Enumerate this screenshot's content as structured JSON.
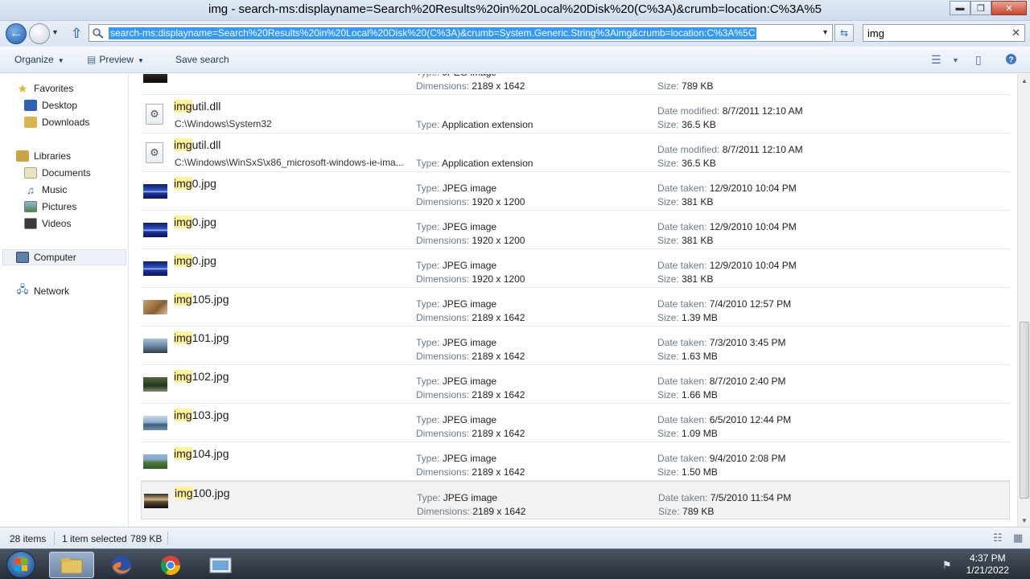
{
  "window": {
    "title": "img - search-ms:displayname=Search%20Results%20in%20Local%20Disk%20(C%3A)&crumb=location:C%3A%5",
    "min_glyph": "▬",
    "max_glyph": "❐",
    "close_glyph": "✕"
  },
  "address": {
    "url": "search-ms:displayname=Search%20Results%20in%20Local%20Disk%20(C%3A)&crumb=System.Generic.String%3Aimg&crumb=location:C%3A%5C",
    "back_glyph": "←",
    "up_glyph": "⇧",
    "refresh_glyph": "⇆"
  },
  "search": {
    "value": "img",
    "clear_glyph": "✕"
  },
  "toolbar": {
    "organize": "Organize",
    "preview": "Preview",
    "save_search": "Save search"
  },
  "navpane": {
    "favorites": "Favorites",
    "desktop": "Desktop",
    "downloads": "Downloads",
    "libraries": "Libraries",
    "documents": "Documents",
    "music": "Music",
    "pictures": "Pictures",
    "videos": "Videos",
    "computer": "Computer",
    "network": "Network"
  },
  "labels": {
    "type": "Type:",
    "dimensions": "Dimensions:",
    "date_taken": "Date taken:",
    "date_modified": "Date modified:",
    "size": "Size:"
  },
  "partial_row": {
    "type": "JPEG image",
    "dimensions": "2189 x 1642",
    "size": "789 KB"
  },
  "files": [
    {
      "hl": "img",
      "rest": "util.dll",
      "path": "C:\\Windows\\System32",
      "kind": "dll",
      "type": "Application extension",
      "dimensions": "",
      "date_label": "Date modified:",
      "date": "8/7/2011 12:10 AM",
      "size": "36.5 KB"
    },
    {
      "hl": "img",
      "rest": "util.dll",
      "path": "C:\\Windows\\WinSxS\\x86_microsoft-windows-ie-ima...",
      "kind": "dll",
      "type": "Application extension",
      "dimensions": "",
      "date_label": "Date modified:",
      "date": "8/7/2011 12:10 AM",
      "size": "36.5 KB"
    },
    {
      "hl": "img",
      "rest": "0.jpg",
      "path": "",
      "kind": "blue",
      "type": "JPEG image",
      "dimensions": "1920 x 1200",
      "date_label": "Date taken:",
      "date": "12/9/2010 10:04 PM",
      "size": "381 KB"
    },
    {
      "hl": "img",
      "rest": "0.jpg",
      "path": "",
      "kind": "blue",
      "type": "JPEG image",
      "dimensions": "1920 x 1200",
      "date_label": "Date taken:",
      "date": "12/9/2010 10:04 PM",
      "size": "381 KB"
    },
    {
      "hl": "img",
      "rest": "0.jpg",
      "path": "",
      "kind": "blue",
      "type": "JPEG image",
      "dimensions": "1920 x 1200",
      "date_label": "Date taken:",
      "date": "12/9/2010 10:04 PM",
      "size": "381 KB"
    },
    {
      "hl": "img",
      "rest": "105.jpg",
      "path": "",
      "kind": "sand",
      "type": "JPEG image",
      "dimensions": "2189 x 1642",
      "date_label": "Date taken:",
      "date": "7/4/2010 12:57 PM",
      "size": "1.39 MB"
    },
    {
      "hl": "img",
      "rest": "101.jpg",
      "path": "",
      "kind": "city",
      "type": "JPEG image",
      "dimensions": "2189 x 1642",
      "date_label": "Date taken:",
      "date": "7/3/2010 3:45 PM",
      "size": "1.63 MB"
    },
    {
      "hl": "img",
      "rest": "102.jpg",
      "path": "",
      "kind": "forest",
      "type": "JPEG image",
      "dimensions": "2189 x 1642",
      "date_label": "Date taken:",
      "date": "8/7/2010 2:40 PM",
      "size": "1.66 MB"
    },
    {
      "hl": "img",
      "rest": "103.jpg",
      "path": "",
      "kind": "lake",
      "type": "JPEG image",
      "dimensions": "2189 x 1642",
      "date_label": "Date taken:",
      "date": "6/5/2010 12:44 PM",
      "size": "1.09 MB"
    },
    {
      "hl": "img",
      "rest": "104.jpg",
      "path": "",
      "kind": "hills",
      "type": "JPEG image",
      "dimensions": "2189 x 1642",
      "date_label": "Date taken:",
      "date": "9/4/2010 2:08 PM",
      "size": "1.50 MB"
    },
    {
      "hl": "img",
      "rest": "100.jpg",
      "path": "",
      "kind": "sunset",
      "type": "JPEG image",
      "dimensions": "2189 x 1642",
      "date_label": "Date taken:",
      "date": "7/5/2010 11:54 PM",
      "size": "789 KB",
      "selected": true
    }
  ],
  "status": {
    "items": "28 items",
    "selected": "1 item selected",
    "size": "789 KB"
  },
  "clock": {
    "time": "4:37 PM",
    "date": "1/21/2022"
  },
  "colors": {
    "highlight": "#fff09a",
    "selection": "#3399ff",
    "label_gray": "#6d7b8d"
  }
}
